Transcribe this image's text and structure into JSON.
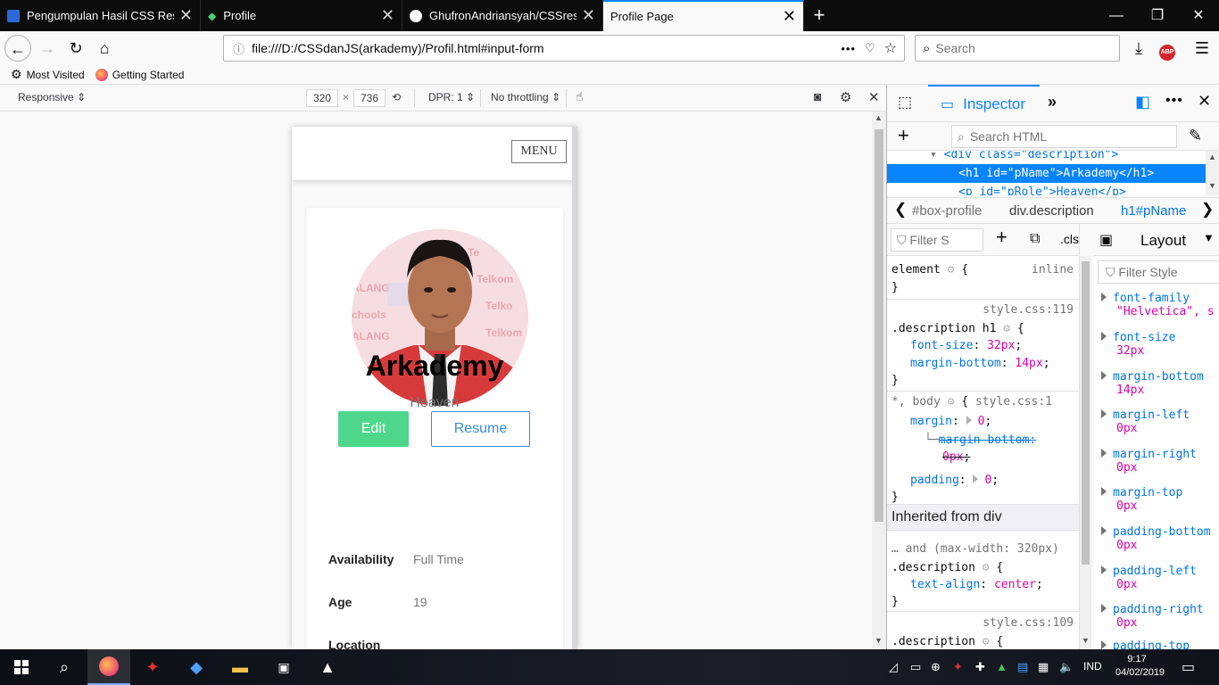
{
  "browser": {
    "tabs": [
      {
        "title": "Pengumpulan Hasil CSS Respo",
        "favicon": "classroom-icon",
        "color": "#2d6ad8",
        "active": false
      },
      {
        "title": "Profile",
        "favicon": "codepen-icon",
        "color": "#47cf73",
        "active": false
      },
      {
        "title": "GhufronAndriansyah/CSSrespo",
        "favicon": "github-icon",
        "color": "#ffffff",
        "active": false
      },
      {
        "title": "Profile Page",
        "favicon": "",
        "color": "",
        "active": true
      }
    ],
    "url": "file:///D:/CSSdanJS(arkademy)/Profil.html#input-form",
    "search_placeholder": "Search",
    "bookmarks": [
      {
        "label": "Most Visited",
        "icon": "gear-icon"
      },
      {
        "label": "Getting Started",
        "icon": "firefox-icon"
      }
    ]
  },
  "rdm": {
    "device": "Responsive",
    "width": "320",
    "height": "736",
    "dpr": "DPR: 1",
    "throttling": "No throttling"
  },
  "page": {
    "menu_label": "MENU",
    "name": "Arkademy",
    "role": "Heaven",
    "edit_label": "Edit",
    "resume_label": "Resume",
    "info": [
      {
        "label": "Availability",
        "value": "Full Time"
      },
      {
        "label": "Age",
        "value": "19"
      },
      {
        "label": "Location",
        "value": ""
      }
    ],
    "colors": {
      "edit": "#4ed78a",
      "resume": "#3b8bd8"
    }
  },
  "devtools": {
    "inspector_label": "Inspector",
    "search_html_placeholder": "Search HTML",
    "markup": {
      "line1": "<div class=\"description\">",
      "line2_tag_open": "<h1 id=\"pName\">",
      "line2_text": "Arkademy",
      "line2_tag_close": "</h1>",
      "line3": "<p id=\"pRole\">Heaven</p>"
    },
    "breadcrumbs": [
      "#box-profile",
      "div.description",
      "h1#pName"
    ],
    "rules": {
      "filter_placeholder": "Filter S",
      "cls": ".cls",
      "element_selector": "element",
      "element_source": "inline",
      "rule1_source": "style.css:119",
      "rule1_selector": ".description h1",
      "rule1_props": [
        {
          "name": "font-size",
          "value": "32px"
        },
        {
          "name": "margin-bottom",
          "value": "14px"
        }
      ],
      "rule2_selector": "*, body",
      "rule2_source": "style.css:1",
      "rule2_margin_name": "margin",
      "rule2_margin_value": "0",
      "rule2_overridden_name": "margin-bottom:",
      "rule2_overridden_value": "0px",
      "rule2_padding_name": "padding",
      "rule2_padding_value": "0",
      "inherited_label": "Inherited from div",
      "rule3_media": "… and (max-width: 320px)",
      "rule3_selector": ".description",
      "rule3_prop_name": "text-align",
      "rule3_prop_value": "center",
      "rule4_source": "style.css:109",
      "rule4_selector": ".description"
    },
    "side": {
      "layout_label": "Layout",
      "filter_placeholder": "Filter Style",
      "computed": [
        {
          "name": "font-family",
          "value": "\"Helvetica\", s"
        },
        {
          "name": "font-size",
          "value": "32px"
        },
        {
          "name": "margin-bottom",
          "value": "14px"
        },
        {
          "name": "margin-left",
          "value": "0px"
        },
        {
          "name": "margin-right",
          "value": "0px"
        },
        {
          "name": "margin-top",
          "value": "0px"
        },
        {
          "name": "padding-bottom",
          "value": "0px"
        },
        {
          "name": "padding-left",
          "value": "0px"
        },
        {
          "name": "padding-right",
          "value": "0px"
        },
        {
          "name": "padding-top",
          "value": ""
        }
      ]
    }
  },
  "taskbar": {
    "lang": "IND",
    "time": "9:17",
    "date": "04/02/2019"
  }
}
